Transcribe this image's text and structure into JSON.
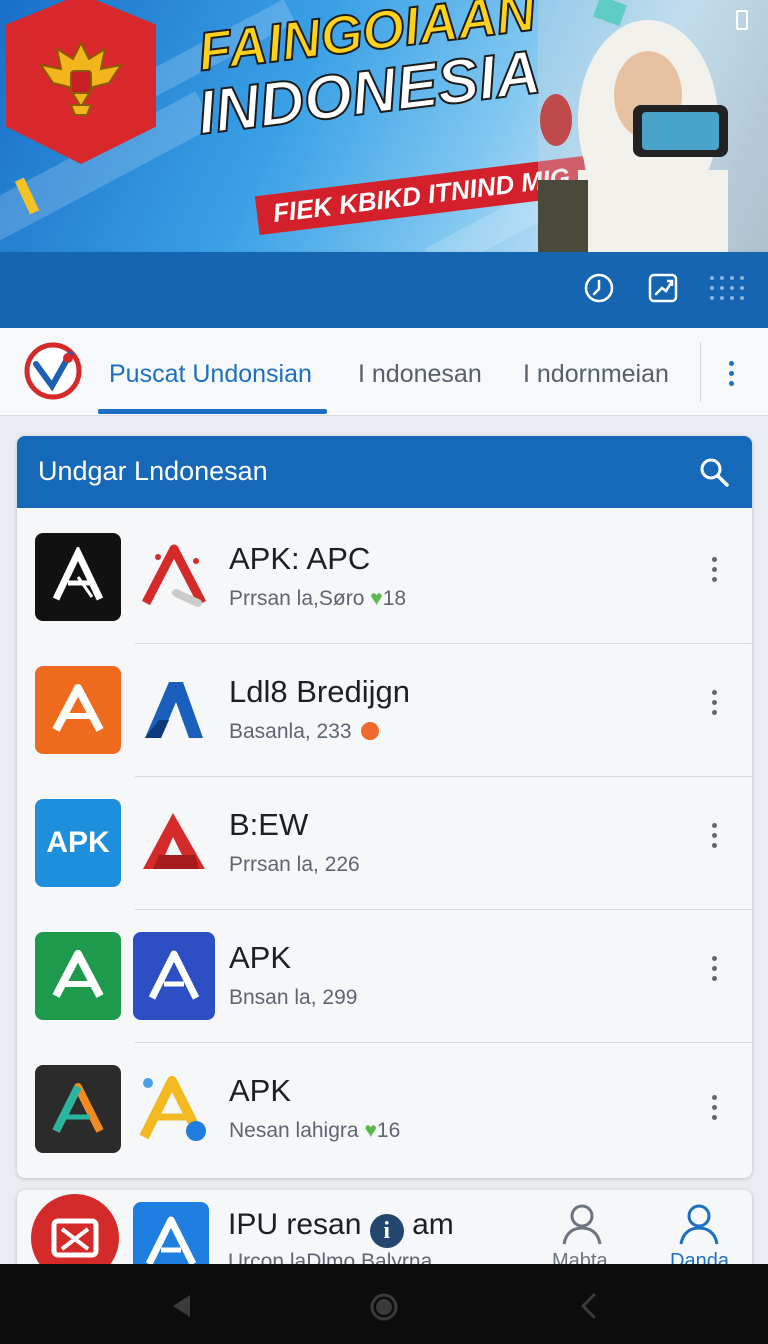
{
  "banner": {
    "headline_line1": "FAINGOIAAN",
    "headline_line2": "INDONESIA",
    "ribbon": "FIEK KBIKD ITNIND MIG"
  },
  "toolbar": {
    "icons": [
      "clock-icon",
      "edit-icon",
      "grid-icon"
    ]
  },
  "tabs": [
    {
      "label": "Puscat Undonsian",
      "active": true
    },
    {
      "label": "I ndonesan",
      "active": false
    },
    {
      "label": "I ndornmeian",
      "active": false
    }
  ],
  "list": {
    "header": "Undgar Lndonesan",
    "items": [
      {
        "title": "APK: APC",
        "subtitle": "Prrsan la,Søro",
        "badge": "18",
        "badge_icon": "heart-icon"
      },
      {
        "title": "Ldl8 Bredijgn",
        "subtitle": "Basanla, 233",
        "badge": "",
        "badge_icon": "angry-face-icon"
      },
      {
        "title": "B:EW",
        "subtitle": "Prrsan la, 226",
        "badge": "",
        "badge_icon": ""
      },
      {
        "title": "APK",
        "subtitle": "Bnsan la, 299",
        "badge": "",
        "badge_icon": ""
      },
      {
        "title": "APK",
        "subtitle": "Nesan lahigra",
        "badge": "16",
        "badge_icon": "heart-icon"
      }
    ]
  },
  "peek": {
    "title_a": "IPU resan",
    "title_b": "am",
    "subtitle": "Urcon laDlmo",
    "subtitle_b": "Balyrna",
    "nav": [
      {
        "label": "Mabta",
        "active": false
      },
      {
        "label": "Danda",
        "active": true
      }
    ]
  },
  "colors": {
    "primary": "#1668b8",
    "tab_active": "#1d6fc2",
    "ribbon": "#d4202a",
    "headline_yellow": "#ffd21a"
  },
  "icon_labels": {
    "apk_badge": "APK"
  }
}
